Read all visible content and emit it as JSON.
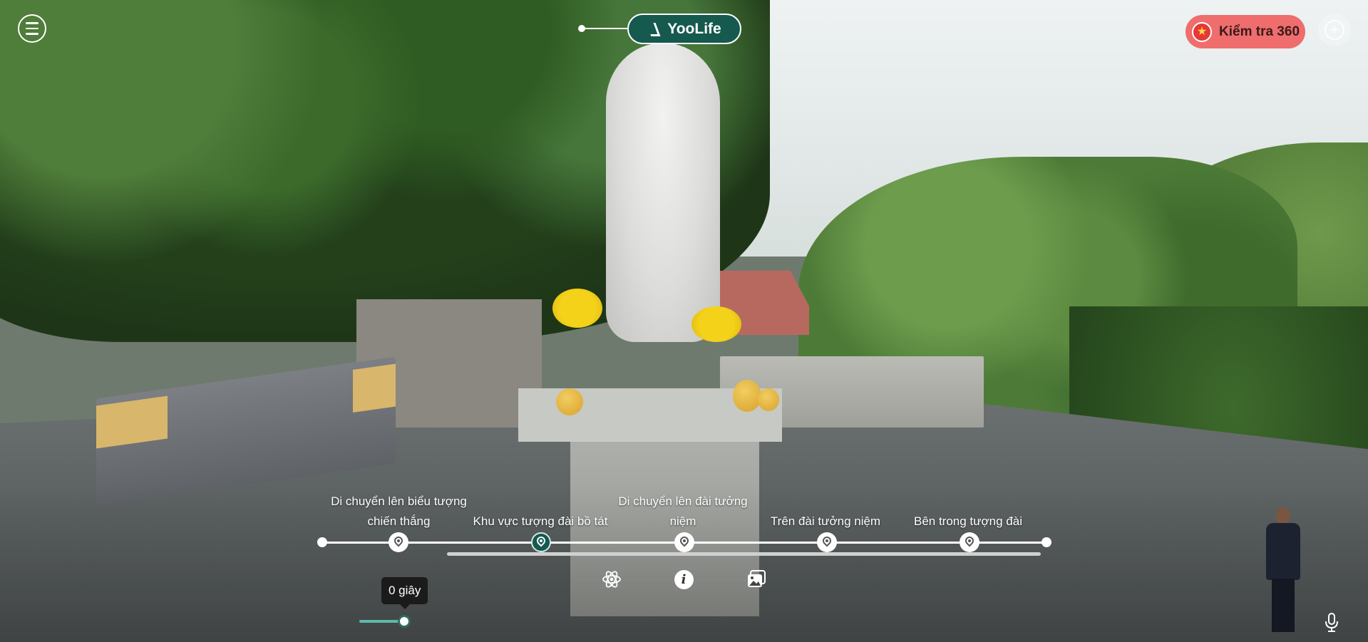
{
  "app": {
    "logo_text": "YooLife",
    "check_button_label": "Kiểm tra 360",
    "brand_color": "#15594f",
    "check_button_color": "#ef6d6d"
  },
  "icons": {
    "menu": "hamburger-menu-icon",
    "check": "star-icon",
    "add": "plus-icon",
    "stop": "map-pin-icon",
    "atom": "atom-icon",
    "info": "info-icon",
    "gallery": "image-gallery-icon",
    "mic": "microphone-icon"
  },
  "timeline": {
    "stops": [
      {
        "label": "Di chuyển lên biểu tượng chiến thắng",
        "active": false
      },
      {
        "label": "Khu vực tượng đài bồ tát",
        "active": true
      },
      {
        "label": "Di chuyển lên đài tưởng niệm",
        "active": false
      },
      {
        "label": "Trên đài tưởng niệm",
        "active": false
      },
      {
        "label": "Bên trong tượng đài",
        "active": false
      }
    ]
  },
  "playback": {
    "tooltip": "0 giây",
    "seconds": 0
  }
}
